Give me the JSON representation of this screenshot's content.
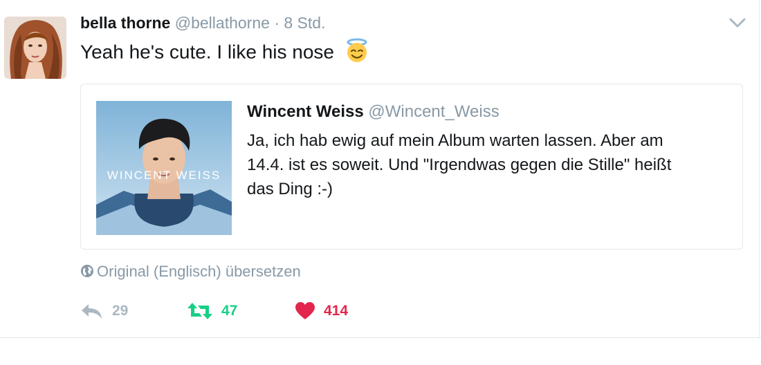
{
  "tweet": {
    "author_name": "bella thorne",
    "author_handle": "@bellathorne",
    "separator": "·",
    "time": "8 Std.",
    "text": "Yeah he's cute. I like his nose",
    "emoji": "smiling-face-with-halo-emoji"
  },
  "quoted": {
    "author_name": "Wincent Weiss",
    "author_handle": "@Wincent_Weiss",
    "lines": [
      "Ja, ich hab ewig auf mein Album warten lassen. Aber am",
      "14.4. ist es soweit. Und \"Irgendwas gegen die Stille\" heißt",
      "das Ding :-)"
    ],
    "image_caption": "WINCENT WEISS"
  },
  "translate_label": "Original (Englisch) übersetzen",
  "actions": {
    "replies": "29",
    "retweets": "47",
    "likes": "414"
  },
  "colors": {
    "muted": "#8899a6",
    "retweet": "#19cf86",
    "like": "#e2264d",
    "border": "#e1e8ed"
  }
}
